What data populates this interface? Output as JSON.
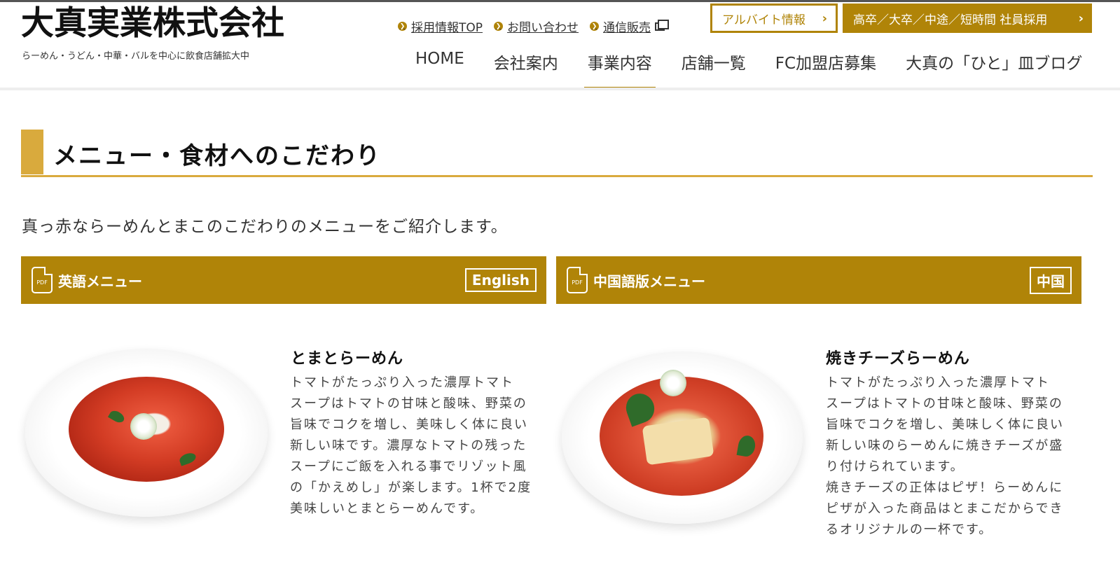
{
  "header": {
    "logo": "大真実業株式会社",
    "tagline": "らーめん・うどん・中華・バルを中心に飲食店舗拡大中",
    "util_links": [
      "採用情報TOP",
      "お問い合わせ",
      "通信販売"
    ],
    "arbeit_button": "アルバイト情報",
    "recruit_button": "高卒／大卒／中途／短時間 社員採用",
    "nav": [
      "HOME",
      "会社案内",
      "事業内容",
      "店舗一覧",
      "FC加盟店募集",
      "大真の「ひと」皿ブログ"
    ],
    "active_nav": "事業内容"
  },
  "section": {
    "title": "メニュー・食材へのこだわり",
    "intro": "真っ赤ならーめんとまこのこだわりのメニューをご紹介します。"
  },
  "pdf_menus": [
    {
      "label": "英語メニュー",
      "button": "English",
      "icon_text": "PDF"
    },
    {
      "label": "中国語版メニュー",
      "button": "中国",
      "icon_text": "PDF"
    }
  ],
  "dishes": [
    {
      "name": "とまとらーめん",
      "lines": [
        "トマトがたっぷり入った濃厚トマト",
        "スープはトマトの甘味と酸味、野菜の",
        "旨味でコクを増し、美味しく体に良い",
        "新しい味です。濃厚なトマトの残った",
        "スープにご飯を入れる事でリゾット風",
        "の「かえめし」が楽します。1杯で2度",
        "美味しいとまとらーめんです。"
      ]
    },
    {
      "name": "焼きチーズらーめん",
      "lines": [
        "トマトがたっぷり入った濃厚トマト",
        "スープはトマトの甘味と酸味、野菜の",
        "旨味でコクを増し、美味しく体に良い",
        "新しい味のらーめんに焼きチーズが盛",
        "り付けられています。",
        "焼きチーズの正体はピザ！らーめんに",
        "ピザが入った商品はとまこだからでき",
        "るオリジナルの一杯です。"
      ]
    }
  ],
  "colors": {
    "brand_gold": "#b08408",
    "accent_gold": "#d9aa3d"
  }
}
